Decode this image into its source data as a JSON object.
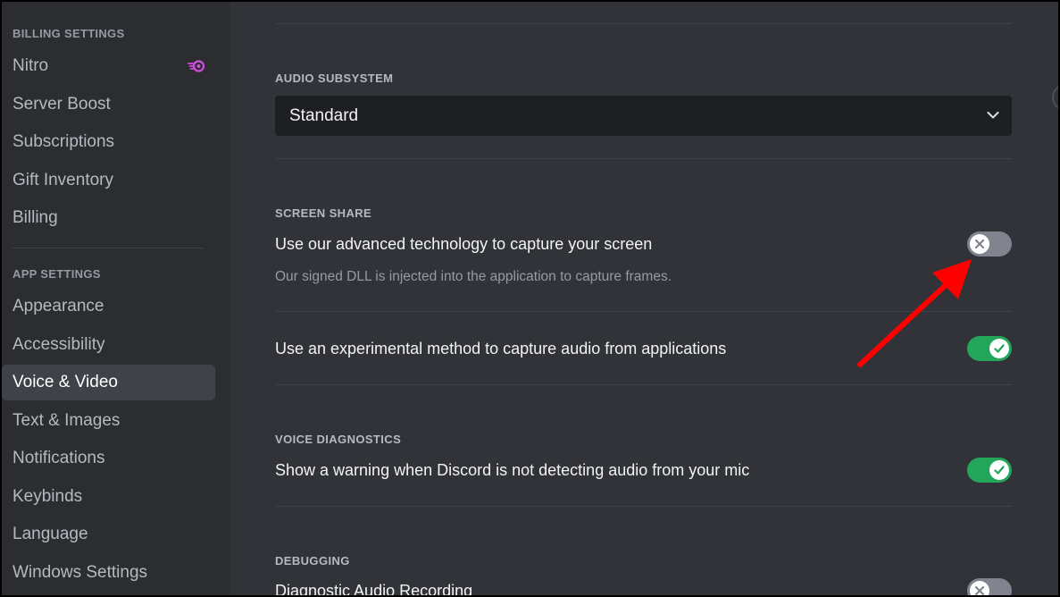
{
  "sidebar": {
    "billing_header": "BILLING SETTINGS",
    "billing_items": [
      {
        "label": "Nitro",
        "icon": "nitro-icon"
      },
      {
        "label": "Server Boost"
      },
      {
        "label": "Subscriptions"
      },
      {
        "label": "Gift Inventory"
      },
      {
        "label": "Billing"
      }
    ],
    "app_header": "APP SETTINGS",
    "app_items": [
      {
        "label": "Appearance"
      },
      {
        "label": "Accessibility"
      },
      {
        "label": "Voice & Video",
        "selected": true
      },
      {
        "label": "Text & Images"
      },
      {
        "label": "Notifications"
      },
      {
        "label": "Keybinds"
      },
      {
        "label": "Language"
      },
      {
        "label": "Windows Settings"
      }
    ]
  },
  "main": {
    "audio_subsystem": {
      "header": "AUDIO SUBSYSTEM",
      "value": "Standard"
    },
    "screen_share": {
      "header": "SCREEN SHARE",
      "advanced_label": "Use our advanced technology to capture your screen",
      "advanced_desc": "Our signed DLL is injected into the application to capture frames.",
      "advanced_enabled": false,
      "experimental_label": "Use an experimental method to capture audio from applications",
      "experimental_enabled": true
    },
    "voice_diagnostics": {
      "header": "VOICE DIAGNOSTICS",
      "warning_label": "Show a warning when Discord is not detecting audio from your mic",
      "warning_enabled": true
    },
    "debugging": {
      "header": "DEBUGGING",
      "diagnostic_label": "Diagnostic Audio Recording",
      "diagnostic_enabled": false
    }
  },
  "colors": {
    "sidebar_bg": "#2b2d31",
    "content_bg": "#313338",
    "selected_bg": "#404249",
    "toggle_on": "#23a55a",
    "toggle_off": "#80848e",
    "nitro_accent": "#d34fe0",
    "annotation_arrow": "#ff0000"
  }
}
